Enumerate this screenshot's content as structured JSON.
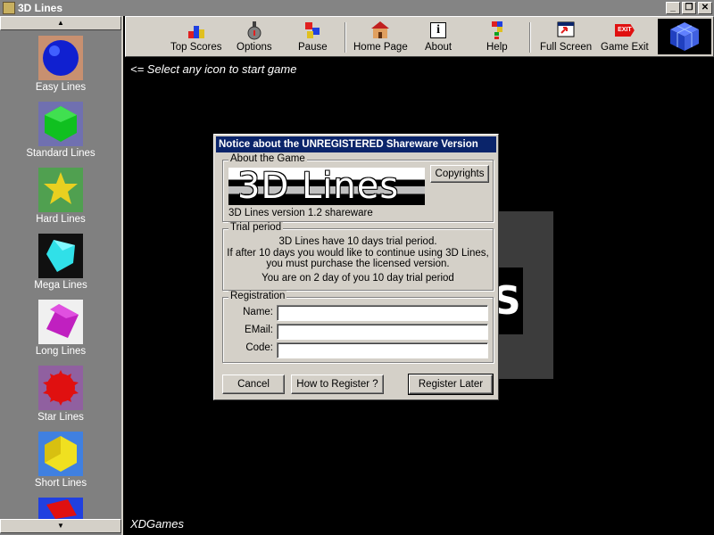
{
  "window": {
    "title": "3D Lines",
    "controls": [
      "_",
      "❐",
      "✕"
    ]
  },
  "sidebar": {
    "scroll_up": "▲",
    "scroll_down": "▼",
    "items": [
      {
        "label": "Easy Lines",
        "icon": "blue-sphere-icon",
        "color": "#1020d0",
        "bg": "#c89070"
      },
      {
        "label": "Standard Lines",
        "icon": "green-ball-icon",
        "color": "#10c020",
        "bg": "#7070b0"
      },
      {
        "label": "Hard Lines",
        "icon": "yellow-star-icon",
        "color": "#e8d020",
        "bg": "#50a050"
      },
      {
        "label": "Mega Lines",
        "icon": "cyan-diamond-icon",
        "color": "#30e0e8",
        "bg": "#101010"
      },
      {
        "label": "Long Lines",
        "icon": "purple-cube-icon",
        "color": "#c020c0",
        "bg": "#f0f0f0"
      },
      {
        "label": "Star Lines",
        "icon": "red-star-icon",
        "color": "#e01010",
        "bg": "#9060a0"
      },
      {
        "label": "Short Lines",
        "icon": "yellow-hexagon-icon",
        "color": "#f0e020",
        "bg": "#4080e0"
      },
      {
        "label": "",
        "icon": "red-cube-icon",
        "color": "#e01010",
        "bg": "#2040e0"
      }
    ]
  },
  "toolbar": {
    "items": [
      {
        "label": "Top Scores",
        "icon": "top-scores-icon"
      },
      {
        "label": "Options",
        "icon": "options-icon"
      },
      {
        "label": "Pause",
        "icon": "pause-icon"
      },
      {
        "label": "Home Page",
        "icon": "home-page-icon"
      },
      {
        "label": "About",
        "icon": "about-icon"
      },
      {
        "label": "Help",
        "icon": "help-icon"
      },
      {
        "label": "Full Screen",
        "icon": "full-screen-icon"
      },
      {
        "label": "Game Exit",
        "icon": "game-exit-icon"
      }
    ],
    "exit_badge": "EXIT",
    "about_glyph": "i"
  },
  "main": {
    "hint": "<= Select any icon to start game",
    "footer": "XDGames",
    "bg_letter": "S"
  },
  "dialog": {
    "title": "Notice about the UNREGISTERED Shareware Version",
    "about": {
      "group_title": "About the Game",
      "logo_text": "3D Lines",
      "copyrights_button": "Copyrights",
      "version": "3D Lines version 1.2 shareware"
    },
    "trial": {
      "group_title": "Trial period",
      "line1": "3D Lines have 10 days trial period.",
      "line2": "If after 10 days you would like to continue using 3D Lines,",
      "line3": "you must purchase the licensed version.",
      "line4": "You are on 2 day of you 10 day trial period"
    },
    "registration": {
      "group_title": "Registration",
      "name_label": "Name:",
      "email_label": "EMail:",
      "code_label": "Code:",
      "name_value": "",
      "email_value": "",
      "code_value": ""
    },
    "buttons": {
      "cancel": "Cancel",
      "how_to_register": "How to Register ?",
      "register_later": "Register Later"
    }
  },
  "colors": {
    "titlebar": "#0a246a",
    "face": "#d4d0c8",
    "sidebar_bg": "#808080"
  }
}
